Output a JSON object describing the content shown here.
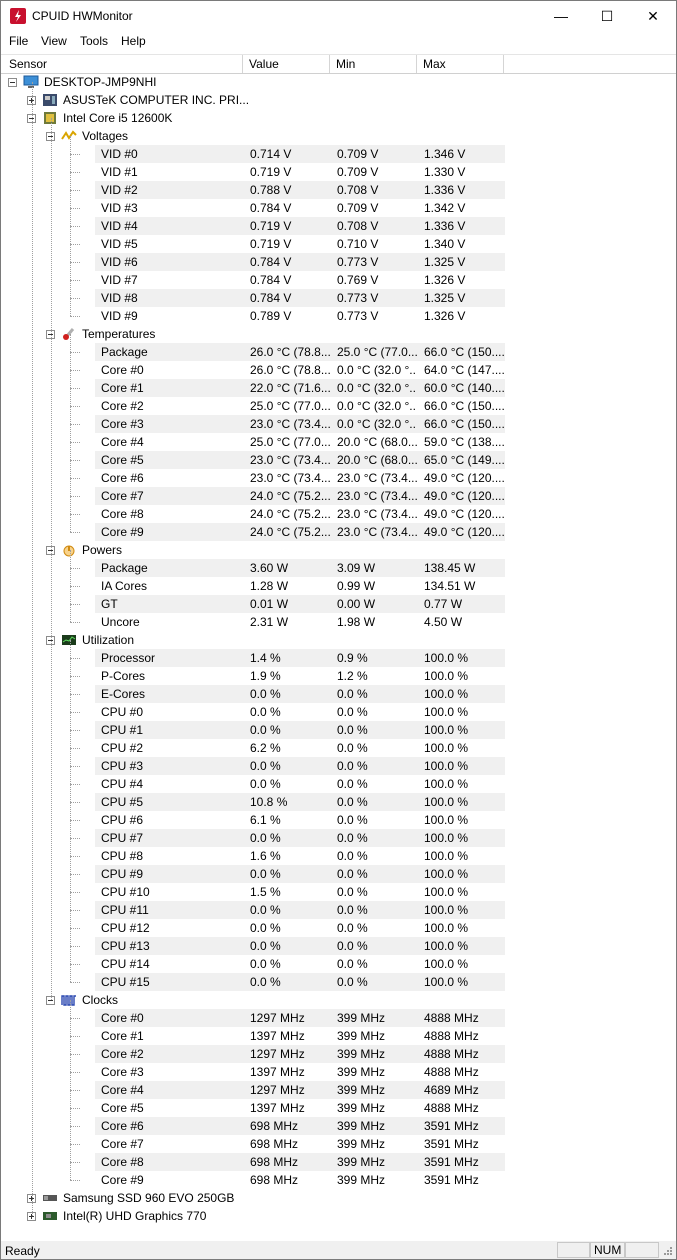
{
  "window": {
    "title": "CPUID HWMonitor",
    "minimize": "—",
    "maximize": "☐",
    "close": "✕"
  },
  "menu": [
    {
      "label": "File"
    },
    {
      "label": "View"
    },
    {
      "label": "Tools"
    },
    {
      "label": "Help"
    }
  ],
  "columns": {
    "sensor": "Sensor",
    "value": "Value",
    "min": "Min",
    "max": "Max"
  },
  "tree": {
    "root": "DESKTOP-JMP9NHI",
    "motherboard": "ASUSTeK COMPUTER INC. PRI...",
    "cpu": "Intel Core i5 12600K",
    "groups": [
      {
        "name": "Voltages",
        "icon": "voltage-icon",
        "rows": [
          [
            "VID #0",
            "0.714 V",
            "0.709 V",
            "1.346 V"
          ],
          [
            "VID #1",
            "0.719 V",
            "0.709 V",
            "1.330 V"
          ],
          [
            "VID #2",
            "0.788 V",
            "0.708 V",
            "1.336 V"
          ],
          [
            "VID #3",
            "0.784 V",
            "0.709 V",
            "1.342 V"
          ],
          [
            "VID #4",
            "0.719 V",
            "0.708 V",
            "1.336 V"
          ],
          [
            "VID #5",
            "0.719 V",
            "0.710 V",
            "1.340 V"
          ],
          [
            "VID #6",
            "0.784 V",
            "0.773 V",
            "1.325 V"
          ],
          [
            "VID #7",
            "0.784 V",
            "0.769 V",
            "1.326 V"
          ],
          [
            "VID #8",
            "0.784 V",
            "0.773 V",
            "1.325 V"
          ],
          [
            "VID #9",
            "0.789 V",
            "0.773 V",
            "1.326 V"
          ]
        ]
      },
      {
        "name": "Temperatures",
        "icon": "thermometer-icon",
        "rows": [
          [
            "Package",
            "26.0 °C  (78.8...",
            "25.0 °C  (77.0...",
            "66.0 °C  (150...."
          ],
          [
            "Core #0",
            "26.0 °C  (78.8...",
            "0.0 °C  (32.0 °...",
            "64.0 °C  (147...."
          ],
          [
            "Core #1",
            "22.0 °C  (71.6...",
            "0.0 °C  (32.0 °...",
            "60.0 °C  (140...."
          ],
          [
            "Core #2",
            "25.0 °C  (77.0...",
            "0.0 °C  (32.0 °...",
            "66.0 °C  (150...."
          ],
          [
            "Core #3",
            "23.0 °C  (73.4...",
            "0.0 °C  (32.0 °...",
            "66.0 °C  (150...."
          ],
          [
            "Core #4",
            "25.0 °C  (77.0...",
            "20.0 °C  (68.0...",
            "59.0 °C  (138...."
          ],
          [
            "Core #5",
            "23.0 °C  (73.4...",
            "20.0 °C  (68.0...",
            "65.0 °C  (149...."
          ],
          [
            "Core #6",
            "23.0 °C  (73.4...",
            "23.0 °C  (73.4...",
            "49.0 °C  (120...."
          ],
          [
            "Core #7",
            "24.0 °C  (75.2...",
            "23.0 °C  (73.4...",
            "49.0 °C  (120...."
          ],
          [
            "Core #8",
            "24.0 °C  (75.2...",
            "23.0 °C  (73.4...",
            "49.0 °C  (120...."
          ],
          [
            "Core #9",
            "24.0 °C  (75.2...",
            "23.0 °C  (73.4...",
            "49.0 °C  (120...."
          ]
        ]
      },
      {
        "name": "Powers",
        "icon": "power-icon",
        "rows": [
          [
            "Package",
            "3.60 W",
            "3.09 W",
            "138.45 W"
          ],
          [
            "IA Cores",
            "1.28 W",
            "0.99 W",
            "134.51 W"
          ],
          [
            "GT",
            "0.01 W",
            "0.00 W",
            "0.77 W"
          ],
          [
            "Uncore",
            "2.31 W",
            "1.98 W",
            "4.50 W"
          ]
        ]
      },
      {
        "name": "Utilization",
        "icon": "utilization-icon",
        "rows": [
          [
            "Processor",
            "1.4 %",
            "0.9 %",
            "100.0 %"
          ],
          [
            "P-Cores",
            "1.9 %",
            "1.2 %",
            "100.0 %"
          ],
          [
            "E-Cores",
            "0.0 %",
            "0.0 %",
            "100.0 %"
          ],
          [
            "CPU #0",
            "0.0 %",
            "0.0 %",
            "100.0 %"
          ],
          [
            "CPU #1",
            "0.0 %",
            "0.0 %",
            "100.0 %"
          ],
          [
            "CPU #2",
            "6.2 %",
            "0.0 %",
            "100.0 %"
          ],
          [
            "CPU #3",
            "0.0 %",
            "0.0 %",
            "100.0 %"
          ],
          [
            "CPU #4",
            "0.0 %",
            "0.0 %",
            "100.0 %"
          ],
          [
            "CPU #5",
            "10.8 %",
            "0.0 %",
            "100.0 %"
          ],
          [
            "CPU #6",
            "6.1 %",
            "0.0 %",
            "100.0 %"
          ],
          [
            "CPU #7",
            "0.0 %",
            "0.0 %",
            "100.0 %"
          ],
          [
            "CPU #8",
            "1.6 %",
            "0.0 %",
            "100.0 %"
          ],
          [
            "CPU #9",
            "0.0 %",
            "0.0 %",
            "100.0 %"
          ],
          [
            "CPU #10",
            "1.5 %",
            "0.0 %",
            "100.0 %"
          ],
          [
            "CPU #11",
            "0.0 %",
            "0.0 %",
            "100.0 %"
          ],
          [
            "CPU #12",
            "0.0 %",
            "0.0 %",
            "100.0 %"
          ],
          [
            "CPU #13",
            "0.0 %",
            "0.0 %",
            "100.0 %"
          ],
          [
            "CPU #14",
            "0.0 %",
            "0.0 %",
            "100.0 %"
          ],
          [
            "CPU #15",
            "0.0 %",
            "0.0 %",
            "100.0 %"
          ]
        ]
      },
      {
        "name": "Clocks",
        "icon": "clock-icon",
        "rows": [
          [
            "Core #0",
            "1297 MHz",
            "399 MHz",
            "4888 MHz"
          ],
          [
            "Core #1",
            "1397 MHz",
            "399 MHz",
            "4888 MHz"
          ],
          [
            "Core #2",
            "1297 MHz",
            "399 MHz",
            "4888 MHz"
          ],
          [
            "Core #3",
            "1397 MHz",
            "399 MHz",
            "4888 MHz"
          ],
          [
            "Core #4",
            "1297 MHz",
            "399 MHz",
            "4689 MHz"
          ],
          [
            "Core #5",
            "1397 MHz",
            "399 MHz",
            "4888 MHz"
          ],
          [
            "Core #6",
            "698 MHz",
            "399 MHz",
            "3591 MHz"
          ],
          [
            "Core #7",
            "698 MHz",
            "399 MHz",
            "3591 MHz"
          ],
          [
            "Core #8",
            "698 MHz",
            "399 MHz",
            "3591 MHz"
          ],
          [
            "Core #9",
            "698 MHz",
            "399 MHz",
            "3591 MHz"
          ]
        ]
      }
    ],
    "ssd": "Samsung SSD 960 EVO 250GB",
    "gpu": "Intel(R) UHD Graphics 770"
  },
  "status": {
    "text": "Ready",
    "num": "NUM"
  }
}
